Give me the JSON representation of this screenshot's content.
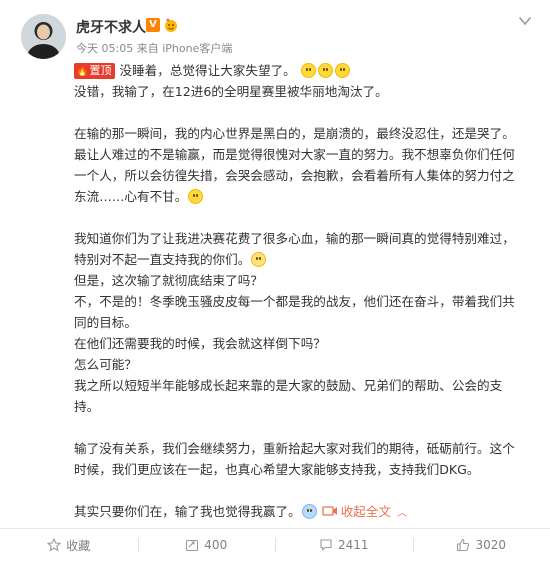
{
  "header": {
    "username": "虎牙不求人",
    "verified_badge": "V",
    "meta": "今天 05:05 来自 iPhone客户端"
  },
  "post": {
    "top_tag": "置顶",
    "lines": [
      "没睡着，总觉得让大家失望了。",
      "没错，我输了，在12进6的全明星赛里被华丽地淘汰了。",
      "在输的那一瞬间，我的内心世界是黑白的，是崩溃的，最终没忍住，还是哭了。",
      "最让人难过的不是输赢，而是觉得很愧对大家一直的努力。我不想辜负你们任何",
      "一个人，所以会彷徨失措，会哭会感动，会抱歉，会看着所有人集体的努力付之",
      "东流……心有不甘。",
      "我知道你们为了让我进决赛花费了很多心血，输的那一瞬间真的觉得特别难过，",
      "特别对不起一直支持我的你们。",
      "但是，这次输了就彻底结束了吗？",
      "不，不是的！冬季晚玉骚皮皮每一个都是我的战友，他们还在奋斗，带着我们共",
      "同的目标。",
      "在他们还需要我的时候，我会就这样倒下吗？",
      "怎么可能？",
      "我之所以短短半年能够成长起来靠的是大家的鼓励、兄弟们的帮助、公会的支",
      "持。",
      "输了没有关系，我们会继续努力，重新拾起大家对我们的期待，砥砺前行。这个",
      "时候，我们更应该在一起，也真心希望大家能够支持我，支持我们DKG。",
      "其实只要你们在，输了我也觉得我赢了。"
    ],
    "collapse_label": "收起全文"
  },
  "actions": {
    "favorite_label": "收藏",
    "repost_count": "400",
    "comment_count": "2411",
    "like_count": "3020"
  },
  "icons": {
    "menu": "chevron-down-icon",
    "favorite": "star-icon",
    "repost": "repost-icon",
    "comment": "comment-icon",
    "like": "thumbs-up-icon"
  },
  "colors": {
    "accent_orange": "#ff8200",
    "top_tag_red": "#e53c2d",
    "link_orange": "#eb7350",
    "muted_gray": "#808080"
  }
}
